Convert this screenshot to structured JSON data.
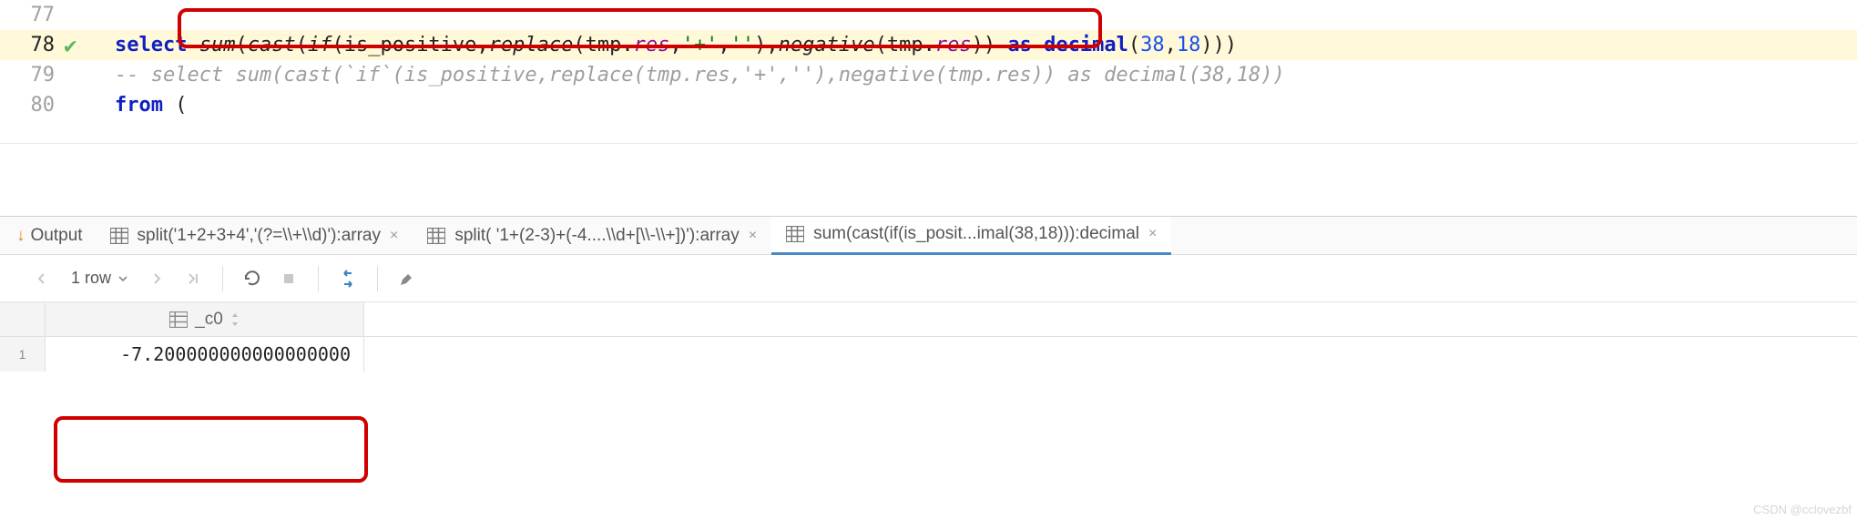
{
  "editor": {
    "lines": [
      {
        "num": "77",
        "current": false,
        "check": false,
        "code_html": ""
      },
      {
        "num": "78",
        "current": true,
        "check": true
      },
      {
        "num": "79",
        "current": false,
        "check": false
      },
      {
        "num": "80",
        "current": false,
        "check": false
      }
    ],
    "line78": {
      "select": "select",
      "sum": "sum",
      "cast": "cast",
      "if": "if",
      "is_positive": "is_positive",
      "replace": "replace",
      "tmp_res_1": "tmp",
      "dot1": ".",
      "res1": "res",
      "str_plus": "'+'",
      "str_empty": "''",
      "negative": "negative",
      "tmp_res_2": "tmp",
      "dot2": ".",
      "res2": "res",
      "as": "as",
      "decimal": "decimal",
      "n38": "38",
      "n18": "18"
    },
    "line79_comment": "-- select sum(cast(`if`(is_positive,replace(tmp.res,'+',''),negative(tmp.res)) as decimal(38,18))",
    "line80": {
      "from": "from",
      "paren": " ("
    }
  },
  "output": {
    "label": "Output",
    "tabs": [
      {
        "label": "split('1+2+3+4','(?=\\\\+\\\\d)'):array",
        "active": false
      },
      {
        "label": "split( '1+(2-3)+(-4....\\\\d+[\\\\-\\\\+])'):array",
        "active": false
      },
      {
        "label": "sum(cast(if(is_posit...imal(38,18))):decimal",
        "active": true
      }
    ]
  },
  "toolbar": {
    "row_count": "1 row"
  },
  "grid": {
    "col_header": "_c0",
    "row_num": "1",
    "value": "-7.200000000000000000"
  },
  "watermark_right": "CSDN @cclovezbf",
  "watermark_left": ""
}
